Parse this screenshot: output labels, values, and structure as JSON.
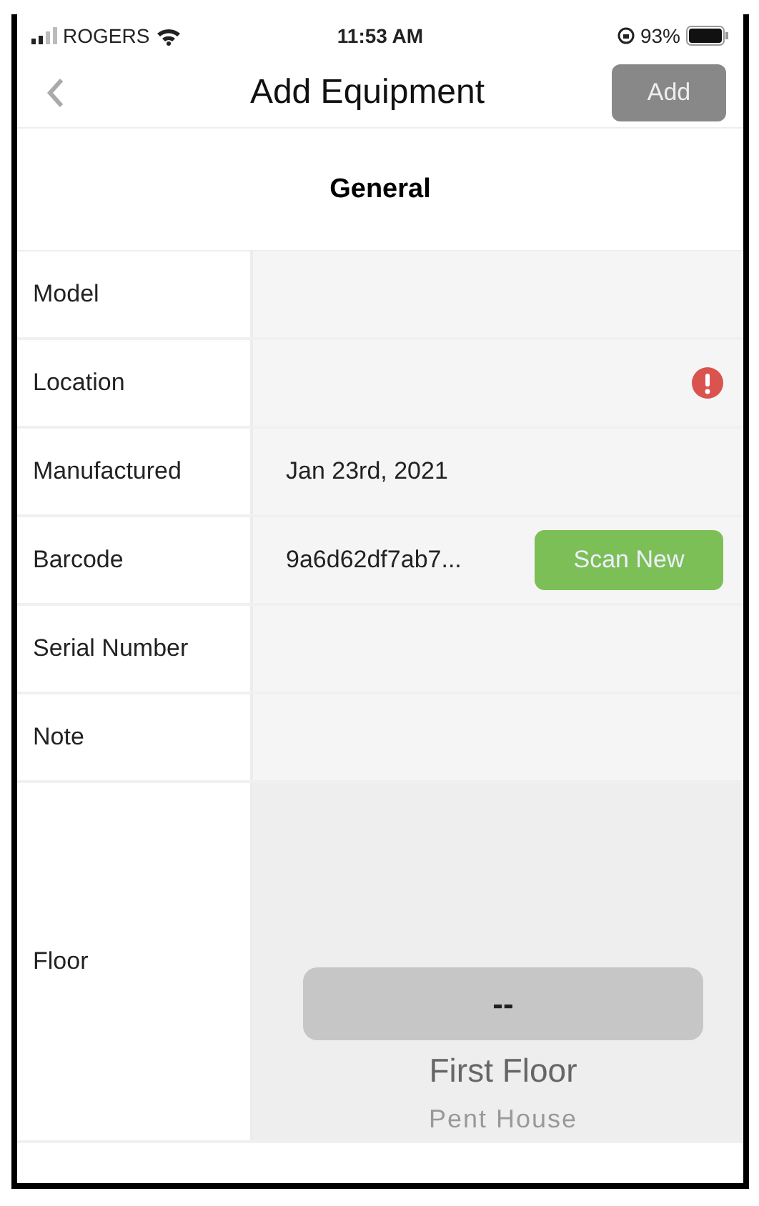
{
  "status_bar": {
    "carrier": "ROGERS",
    "time": "11:53 AM",
    "battery": "93%"
  },
  "nav": {
    "title": "Add Equipment",
    "action": "Add",
    "action_disabled": true
  },
  "section": {
    "title": "General"
  },
  "fields": [
    {
      "kind": "text",
      "label": "Model"
    },
    {
      "kind": "text",
      "label": "Location",
      "error": true
    },
    {
      "kind": "text",
      "label": "Manufactured",
      "value": "Jan 23rd, 2021"
    },
    {
      "kind": "button",
      "label": "Barcode",
      "value": "9a6d62df7ab7...",
      "button": "Scan New"
    },
    {
      "kind": "text",
      "label": "Serial Number"
    },
    {
      "kind": "text",
      "label": "Note"
    },
    {
      "kind": "picker",
      "label": "Floor",
      "options": [
        {
          "label": "--",
          "selected": true
        },
        {
          "label": "First Floor",
          "selected": false
        },
        {
          "label": "Pent House",
          "selected": false
        }
      ]
    }
  ]
}
